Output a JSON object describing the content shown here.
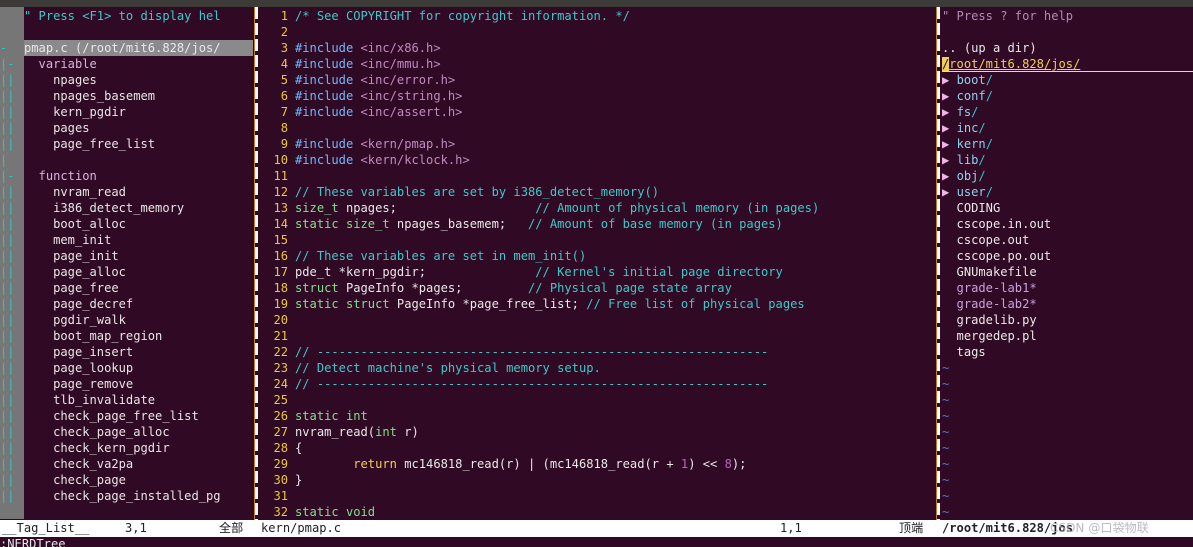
{
  "taglist": {
    "help": "\" Press <F1> to display hel",
    "file": "pmap.c (/root/mit6.828/jos/",
    "groups": [
      {
        "kind": "variable",
        "tags": [
          "npages",
          "npages_basemem",
          "kern_pgdir",
          "pages",
          "page_free_list"
        ]
      },
      {
        "kind": "function",
        "tags": [
          "nvram_read",
          "i386_detect_memory",
          "boot_alloc",
          "mem_init",
          "page_init",
          "page_alloc",
          "page_free",
          "page_decref",
          "pgdir_walk",
          "boot_map_region",
          "page_insert",
          "page_lookup",
          "page_remove",
          "tlb_invalidate",
          "check_page_free_list",
          "check_page_alloc",
          "check_kern_pgdir",
          "check_va2pa",
          "check_page",
          "check_page_installed_pg"
        ]
      }
    ]
  },
  "code": {
    "lines": [
      {
        "n": "1",
        "parts": [
          [
            "c-comment",
            "/* See COPYRIGHT for copyright information. */"
          ]
        ]
      },
      {
        "n": "2",
        "parts": []
      },
      {
        "n": "3",
        "parts": [
          [
            "c-pre",
            "#include "
          ],
          [
            "c-inc",
            "<inc/x86.h>"
          ]
        ]
      },
      {
        "n": "4",
        "parts": [
          [
            "c-pre",
            "#include "
          ],
          [
            "c-inc",
            "<inc/mmu.h>"
          ]
        ]
      },
      {
        "n": "5",
        "parts": [
          [
            "c-pre",
            "#include "
          ],
          [
            "c-inc",
            "<inc/error.h>"
          ]
        ]
      },
      {
        "n": "6",
        "parts": [
          [
            "c-pre",
            "#include "
          ],
          [
            "c-inc",
            "<inc/string.h>"
          ]
        ]
      },
      {
        "n": "7",
        "parts": [
          [
            "c-pre",
            "#include "
          ],
          [
            "c-inc",
            "<inc/assert.h>"
          ]
        ]
      },
      {
        "n": "8",
        "parts": []
      },
      {
        "n": "9",
        "parts": [
          [
            "c-pre",
            "#include "
          ],
          [
            "c-inc",
            "<kern/pmap.h>"
          ]
        ]
      },
      {
        "n": "10",
        "parts": [
          [
            "c-pre",
            "#include "
          ],
          [
            "c-inc",
            "<kern/kclock.h>"
          ]
        ]
      },
      {
        "n": "11",
        "parts": []
      },
      {
        "n": "12",
        "parts": [
          [
            "c-comment",
            "// These variables are set by i386_detect_memory()"
          ]
        ]
      },
      {
        "n": "13",
        "parts": [
          [
            "c-type",
            "size_t"
          ],
          [
            "c-text",
            " npages;                   "
          ],
          [
            "c-comment",
            "// Amount of physical memory (in pages)"
          ]
        ]
      },
      {
        "n": "14",
        "parts": [
          [
            "c-type",
            "static size_t"
          ],
          [
            "c-text",
            " npages_basemem;   "
          ],
          [
            "c-comment",
            "// Amount of base memory (in pages)"
          ]
        ]
      },
      {
        "n": "15",
        "parts": []
      },
      {
        "n": "16",
        "parts": [
          [
            "c-comment",
            "// These variables are set in mem_init()"
          ]
        ]
      },
      {
        "n": "17",
        "parts": [
          [
            "c-text",
            "pde_t *kern_pgdir;               "
          ],
          [
            "c-comment",
            "// Kernel's initial page directory"
          ]
        ]
      },
      {
        "n": "18",
        "parts": [
          [
            "c-type",
            "struct"
          ],
          [
            "c-text",
            " PageInfo *pages;         "
          ],
          [
            "c-comment",
            "// Physical page state array"
          ]
        ]
      },
      {
        "n": "19",
        "parts": [
          [
            "c-type",
            "static struct"
          ],
          [
            "c-text",
            " PageInfo *page_free_list; "
          ],
          [
            "c-comment",
            "// Free list of physical pages"
          ]
        ]
      },
      {
        "n": "20",
        "parts": []
      },
      {
        "n": "21",
        "parts": []
      },
      {
        "n": "22",
        "parts": [
          [
            "c-comment",
            "// --------------------------------------------------------------"
          ]
        ]
      },
      {
        "n": "23",
        "parts": [
          [
            "c-comment",
            "// Detect machine's physical memory setup."
          ]
        ]
      },
      {
        "n": "24",
        "parts": [
          [
            "c-comment",
            "// --------------------------------------------------------------"
          ]
        ]
      },
      {
        "n": "25",
        "parts": []
      },
      {
        "n": "26",
        "parts": [
          [
            "c-type",
            "static int"
          ]
        ]
      },
      {
        "n": "27",
        "parts": [
          [
            "c-text",
            "nvram_read("
          ],
          [
            "c-type",
            "int"
          ],
          [
            "c-text",
            " r)"
          ]
        ]
      },
      {
        "n": "28",
        "parts": [
          [
            "c-text",
            "{"
          ]
        ]
      },
      {
        "n": "29",
        "parts": [
          [
            "c-text",
            "        "
          ],
          [
            "c-stmt",
            "return"
          ],
          [
            "c-text",
            " mc146818_read(r) | (mc146818_read(r + "
          ],
          [
            "c-num",
            "1"
          ],
          [
            "c-text",
            ") << "
          ],
          [
            "c-num",
            "8"
          ],
          [
            "c-text",
            ");"
          ]
        ]
      },
      {
        "n": "30",
        "parts": [
          [
            "c-text",
            "}"
          ]
        ]
      },
      {
        "n": "31",
        "parts": []
      },
      {
        "n": "32",
        "parts": [
          [
            "c-type",
            "static void"
          ]
        ]
      }
    ]
  },
  "nerdtree": {
    "help": "\" Press ? for help",
    "up_dir": ".. (up a dir)",
    "root": "/root/mit6.828/jos/",
    "dirs": [
      "boot",
      "conf",
      "fs",
      "inc",
      "kern",
      "lib",
      "obj",
      "user"
    ],
    "files": [
      {
        "name": "CODING",
        "exec": false
      },
      {
        "name": "cscope.in.out",
        "exec": false
      },
      {
        "name": "cscope.out",
        "exec": false
      },
      {
        "name": "cscope.po.out",
        "exec": false
      },
      {
        "name": "GNUmakefile",
        "exec": false
      },
      {
        "name": "grade-lab1*",
        "exec": true
      },
      {
        "name": "grade-lab2*",
        "exec": true
      },
      {
        "name": "gradelib.py",
        "exec": false
      },
      {
        "name": "mergedep.pl",
        "exec": false
      },
      {
        "name": "tags",
        "exec": false
      }
    ],
    "tilde_lines": 10
  },
  "statusbar": {
    "taglist_name": "__Tag_List__",
    "taglist_pos": "3,1",
    "taglist_scroll": "全部",
    "code_file": "kern/pmap.c",
    "code_pos": "1,1",
    "code_scroll": "顶端",
    "nerd_path": "/root/mit6.828/jos"
  },
  "cmdline": ":NERDTree",
  "watermark": "CSDN @口袋物联"
}
